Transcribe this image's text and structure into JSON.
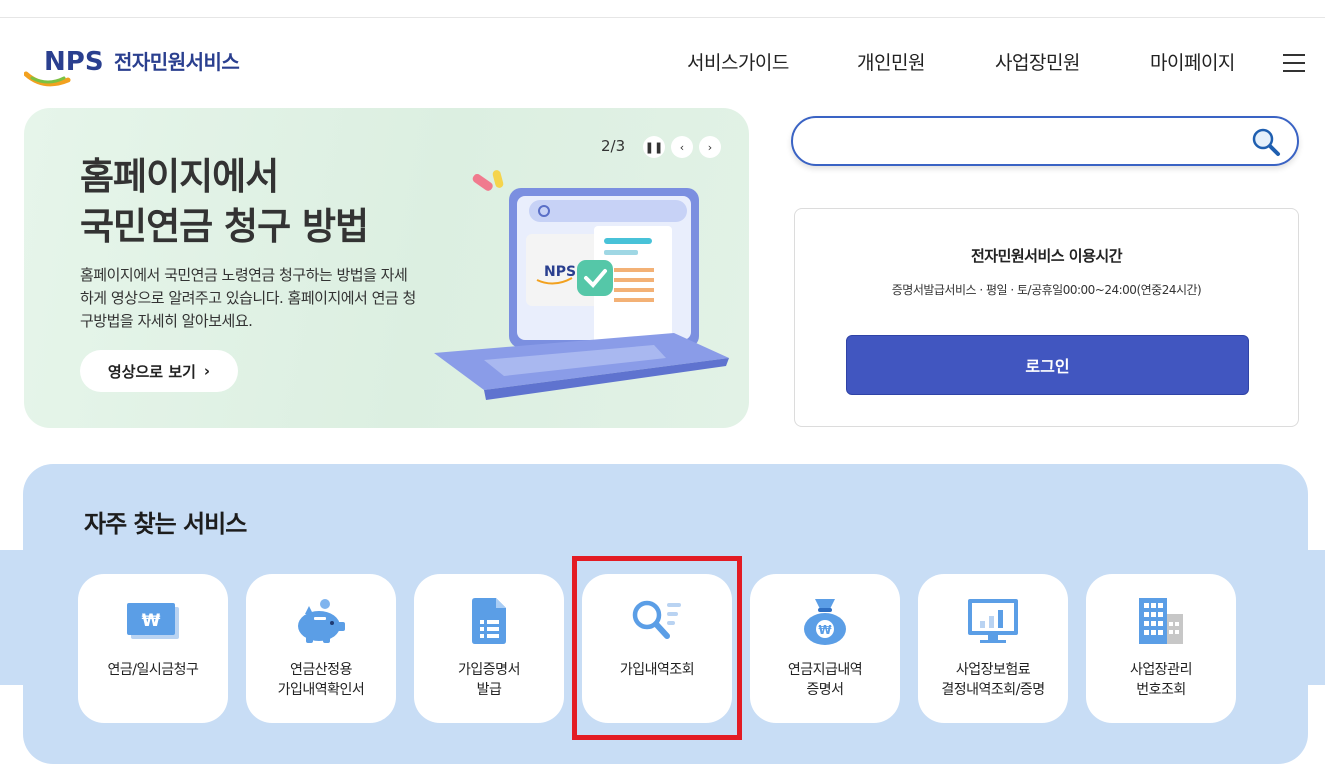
{
  "header": {
    "logo_text": "NPS",
    "logo_sub": "전자민원서비스",
    "nav": [
      {
        "label": "서비스가이드"
      },
      {
        "label": "개인민원"
      },
      {
        "label": "사업장민원"
      },
      {
        "label": "마이페이지"
      }
    ],
    "menu_icon": "hamburger-icon"
  },
  "banner": {
    "title_line1": "홈페이지에서",
    "title_line2": "국민연금 청구 방법",
    "description": "홈페이지에서 국민연금 노령연금 청구하는 방법을 자세하게 영상으로 알려주고 있습니다. 홈페이지에서 연금 청구방법을 자세히 알아보세요.",
    "video_button": "영상으로 보기",
    "slide_counter": "2/3",
    "art_logo": "NPS"
  },
  "search": {
    "value": "",
    "placeholder": "",
    "icon": "search-icon"
  },
  "service_time": {
    "title": "전자민원서비스 이용시간",
    "description": "증명서발급서비스 · 평일 · 토/공휴일00:00~24:00(연중24시간)",
    "login_button": "로그인"
  },
  "frequent": {
    "title": "자주 찾는 서비스",
    "items": [
      {
        "line1": "연금/일시금청구",
        "line2": "",
        "icon": "won-card-icon"
      },
      {
        "line1": "연금산정용",
        "line2": "가입내역확인서",
        "icon": "piggy-bank-icon"
      },
      {
        "line1": "가입증명서",
        "line2": "발급",
        "icon": "document-icon"
      },
      {
        "line1": "가입내역조회",
        "line2": "",
        "icon": "search-list-icon"
      },
      {
        "line1": "연금지급내역",
        "line2": "증명서",
        "icon": "money-bag-icon"
      },
      {
        "line1": "사업장보험료",
        "line2": "결정내역조회/증명",
        "icon": "monitor-chart-icon"
      },
      {
        "line1": "사업장관리",
        "line2": "번호조회",
        "icon": "building-icon"
      }
    ]
  },
  "colors": {
    "brand_blue": "#2a3f8f",
    "login_blue": "#4156c0",
    "section_bg": "#c8ddf5",
    "banner_bg": "#e2f2e6",
    "highlight_red": "#e31b23"
  }
}
